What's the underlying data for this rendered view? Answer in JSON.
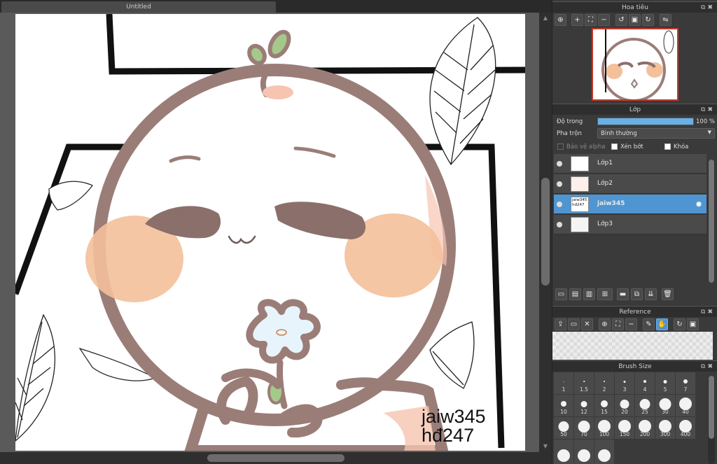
{
  "document": {
    "tab_title": "Untitled"
  },
  "canvas": {
    "watermark_line1": "jaiw345",
    "watermark_line2": "hđ247"
  },
  "navigator": {
    "title": "Hoa tiêu"
  },
  "layers": {
    "title": "Lớp",
    "opacity_label": "Độ trong",
    "opacity_value": "100 %",
    "opacity_fraction": 1.0,
    "blend_label": "Pha trộn",
    "blend_value": "Bình thường",
    "protect_alpha": "Bảo vệ alpha",
    "clipping": "Xén bớt",
    "lock": "Khóa",
    "items": [
      {
        "name": "Lớp1"
      },
      {
        "name": "Lớp2"
      },
      {
        "name": "jaiw345",
        "thumb_text": "jaiw345 hđ247"
      },
      {
        "name": "Lớp3"
      }
    ]
  },
  "reference": {
    "title": "Reference"
  },
  "brush": {
    "title": "Brush Size",
    "sizes": [
      "1",
      "1.5",
      "2",
      "3",
      "4",
      "5",
      "7",
      "10",
      "12",
      "15",
      "20",
      "25",
      "30",
      "40",
      "50",
      "70",
      "100",
      "150",
      "200",
      "300",
      "400"
    ]
  },
  "colors": {
    "accent": "#4f95d1",
    "cheek": "#f4c09a",
    "outline": "#9b7d78",
    "leaf": "#a5c98a"
  }
}
